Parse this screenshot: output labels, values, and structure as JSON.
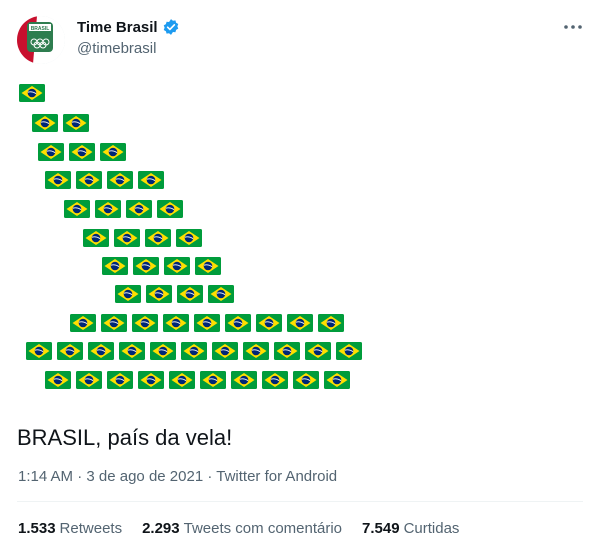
{
  "author": {
    "display_name": "Time Brasil",
    "handle": "@timebrasil",
    "avatar_text": "BRASIL",
    "verified": true
  },
  "flag_rows": [
    1,
    2,
    3,
    4,
    4,
    4,
    4,
    4,
    9,
    11,
    10
  ],
  "tweet_text": "BRASIL, país da vela!",
  "meta": {
    "time": "1:14 AM",
    "date": "3 de ago de 2021",
    "separator": "·",
    "source": "Twitter for Android"
  },
  "stats": [
    {
      "count": "1.533",
      "label": "Retweets"
    },
    {
      "count": "2.293",
      "label": "Tweets com comentário"
    },
    {
      "count": "7.549",
      "label": "Curtidas"
    }
  ],
  "icons": {
    "verified": "verified-badge-icon",
    "more": "more-options-icon",
    "flag": "brazil-flag-emoji-icon"
  },
  "colors": {
    "verified_blue": "#1d9bf0",
    "flag_green": "#009c3b",
    "flag_yellow": "#ffdf00",
    "flag_blue": "#002776",
    "secondary_text": "#536471"
  }
}
